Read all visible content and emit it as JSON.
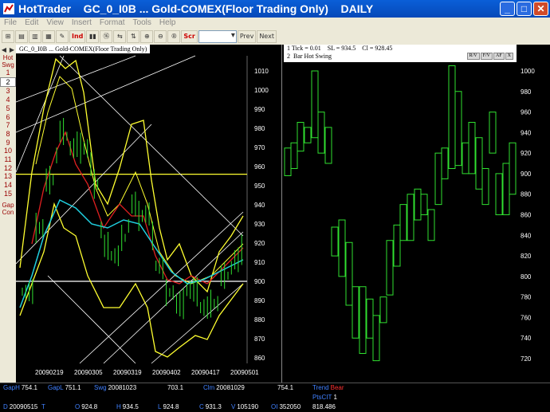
{
  "window": {
    "app_name": "HotTrader",
    "title": "HotTrader    GC_0_I0B ... Gold-COMEX(Floor Trading Only)    DAILY",
    "minimize": "_",
    "maximize": "□",
    "close": "✕"
  },
  "menu": [
    "File",
    "Edit",
    "View",
    "Insert",
    "Format",
    "Tools",
    "Help"
  ],
  "toolbar": {
    "buttons": [
      "⊞",
      "▤",
      "▥",
      "▦",
      "✎",
      "Ind",
      "▮▮",
      "⑯",
      "⇆",
      "⇅",
      "⊕",
      "⊖",
      "®",
      "Scr"
    ],
    "prev_label": "Prev",
    "next_label": "Next"
  },
  "sidebar": {
    "top_label_1": "Hot",
    "top_label_2": "Swg",
    "items": [
      "1",
      "2",
      "3",
      "4",
      "5",
      "6",
      "7",
      "8",
      "9",
      "10",
      "11",
      "12",
      "13",
      "14",
      "15"
    ],
    "selected_index": 1,
    "bottom_label_1": "Gap",
    "bottom_label_2": "Con"
  },
  "left_chart": {
    "header": "GC_0_I0B ... Gold-COMEX(Floor Trading Only)",
    "y_ticks": [
      1010,
      1000,
      990,
      980,
      970,
      960,
      950,
      940,
      930,
      920,
      910,
      900,
      890,
      880,
      870,
      860
    ],
    "x_ticks": [
      "20090219",
      "20090305",
      "20090319",
      "20090402",
      "20090417",
      "20090501"
    ]
  },
  "right_chart": {
    "info_line_1": "1 Tick = 0.01    SL = 934.5    Cl = 928.45",
    "info_line_2": "2  Bar Hot Swing",
    "controls": [
      "R/V",
      "F/V",
      "AF",
      "X"
    ],
    "y_ticks": [
      1000,
      980,
      960,
      940,
      920,
      900,
      880,
      860,
      840,
      820,
      800,
      780,
      760,
      740,
      720
    ]
  },
  "status": {
    "row1": [
      {
        "k": "GapH",
        "v": "754.1"
      },
      {
        "k": "GapL",
        "v": "751.1"
      },
      {
        "k": "Swg",
        "v": "20081023"
      },
      {
        "k": "",
        "v": "703.1"
      },
      {
        "k": "Clm",
        "v": "20081029"
      },
      {
        "k": "",
        "v": "754.1"
      },
      {
        "k": "Trend",
        "v": "Bear"
      }
    ],
    "row2": [
      {
        "k": "PtsCIT",
        "v": "1"
      }
    ],
    "row3": [
      {
        "k": "D",
        "v": "20090515"
      },
      {
        "k": "T",
        "v": ""
      },
      {
        "k": "O",
        "v": "924.8"
      },
      {
        "k": "H",
        "v": "934.5"
      },
      {
        "k": "L",
        "v": "924.8"
      },
      {
        "k": "C",
        "v": "931.3"
      },
      {
        "k": "V",
        "v": "105190"
      },
      {
        "k": "OI",
        "v": "352050"
      },
      {
        "k": "",
        "v": "818.486"
      }
    ]
  },
  "colors": {
    "titlebar": "#0a5fd8",
    "chrome": "#ece9d8",
    "yellow": "#ffff30",
    "green": "#30e030",
    "red": "#e02020",
    "cyan": "#20d0e0",
    "white": "#ffffff",
    "bear": "#ff3030"
  }
}
